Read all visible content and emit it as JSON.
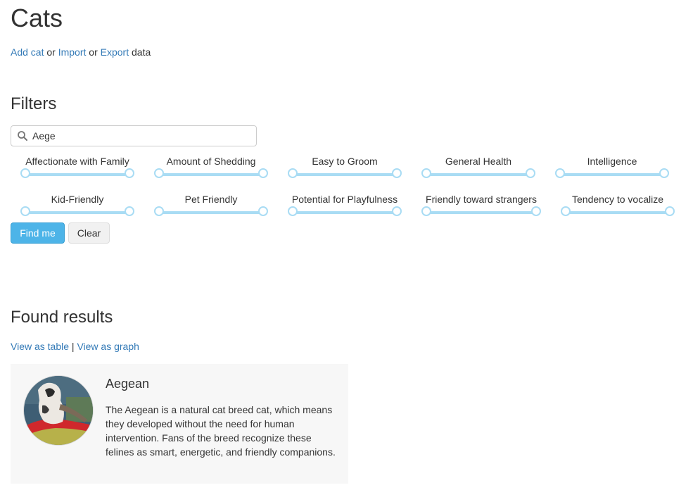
{
  "header": {
    "title": "Cats",
    "add_cat_link": "Add cat",
    "or_1": "or",
    "import_link": "Import",
    "or_2": "or",
    "export_link": "Export",
    "data_text": "data"
  },
  "filters": {
    "title": "Filters",
    "search": {
      "value": "Aege",
      "placeholder": ""
    },
    "sliders": [
      {
        "label": "Affectionate with Family"
      },
      {
        "label": "Amount of Shedding"
      },
      {
        "label": "Easy to Groom"
      },
      {
        "label": "General Health"
      },
      {
        "label": "Intelligence"
      },
      {
        "label": "Kid-Friendly"
      },
      {
        "label": "Pet Friendly"
      },
      {
        "label": "Potential for Playfulness"
      },
      {
        "label": "Friendly toward strangers"
      },
      {
        "label": "Tendency to vocalize"
      }
    ],
    "find_button": "Find me",
    "clear_button": "Clear"
  },
  "results": {
    "title": "Found results",
    "view_table_link": "View as table",
    "separator": "|",
    "view_graph_link": "View as graph",
    "items": [
      {
        "name": "Aegean",
        "description": "The Aegean is a natural cat breed cat, which means they developed without the need for human intervention. Fans of the breed recognize these felines as smart, energetic, and friendly companions."
      }
    ]
  },
  "colors": {
    "link": "#337ab7",
    "primary_button": "#4db4e8",
    "slider_track": "#a9dcf4",
    "card_background": "#f7f7f7"
  }
}
